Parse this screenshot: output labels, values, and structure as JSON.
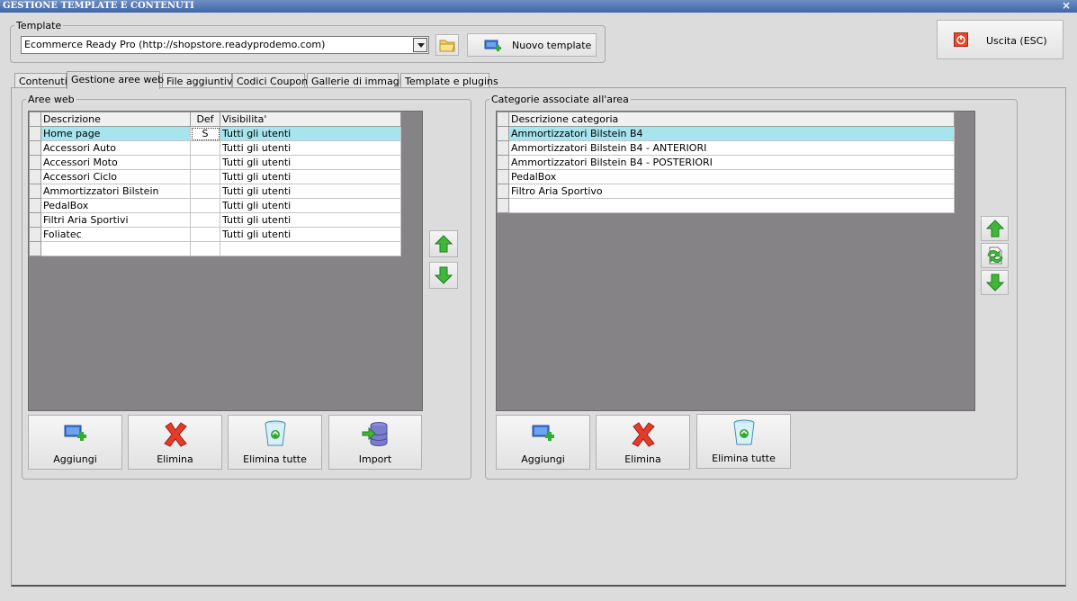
{
  "window": {
    "title": "GESTIONE TEMPLATE E CONTENUTI",
    "close_glyph": "×"
  },
  "template": {
    "legend": "Template",
    "selected": "Ecommerce Ready Pro (http://shopstore.readyprodemo.com)",
    "new_label": "Nuovo template"
  },
  "exit_label": "Uscita (ESC)",
  "tabs": [
    {
      "label": "Contenuti"
    },
    {
      "label": "Gestione aree web"
    },
    {
      "label": "File aggiuntivi"
    },
    {
      "label": "Codici Coupon"
    },
    {
      "label": "Gallerie di immagini"
    },
    {
      "label": "Template e plugins"
    }
  ],
  "areas": {
    "legend": "Aree web",
    "columns": {
      "desc": "Descrizione",
      "def": "Def",
      "vis": "Visibilita'"
    },
    "rows": [
      {
        "desc": "Home page",
        "def": "S",
        "vis": "Tutti gli utenti"
      },
      {
        "desc": "Accessori Auto",
        "def": "",
        "vis": "Tutti gli utenti"
      },
      {
        "desc": "Accessori Moto",
        "def": "",
        "vis": "Tutti gli utenti"
      },
      {
        "desc": "Accessori Ciclo",
        "def": "",
        "vis": "Tutti gli utenti"
      },
      {
        "desc": "Ammortizzatori Bilstein",
        "def": "",
        "vis": "Tutti gli utenti"
      },
      {
        "desc": "PedalBox",
        "def": "",
        "vis": "Tutti gli utenti"
      },
      {
        "desc": "Filtri Aria Sportivi",
        "def": "",
        "vis": "Tutti gli utenti"
      },
      {
        "desc": "Foliatec",
        "def": "",
        "vis": "Tutti gli utenti"
      }
    ],
    "buttons": {
      "add": "Aggiungi",
      "delete": "Elimina",
      "delete_all": "Elimina tutte",
      "import": "Import"
    }
  },
  "categories": {
    "legend": "Categorie associate all'area",
    "column": "Descrizione categoria",
    "rows": [
      "Ammortizzatori Bilstein B4",
      "Ammortizzatori Bilstein B4 - ANTERIORI",
      "Ammortizzatori Bilstein B4 - POSTERIORI",
      "PedalBox",
      "Filtro Aria Sportivo"
    ],
    "buttons": {
      "add": "Aggiungi",
      "delete": "Elimina",
      "delete_all": "Elimina tutte"
    }
  },
  "colors": {
    "titlebar": "#3f66a8",
    "selected_row": "#a6e4ee",
    "grid_bg": "#858385",
    "arrow_green": "#3fb83a"
  }
}
